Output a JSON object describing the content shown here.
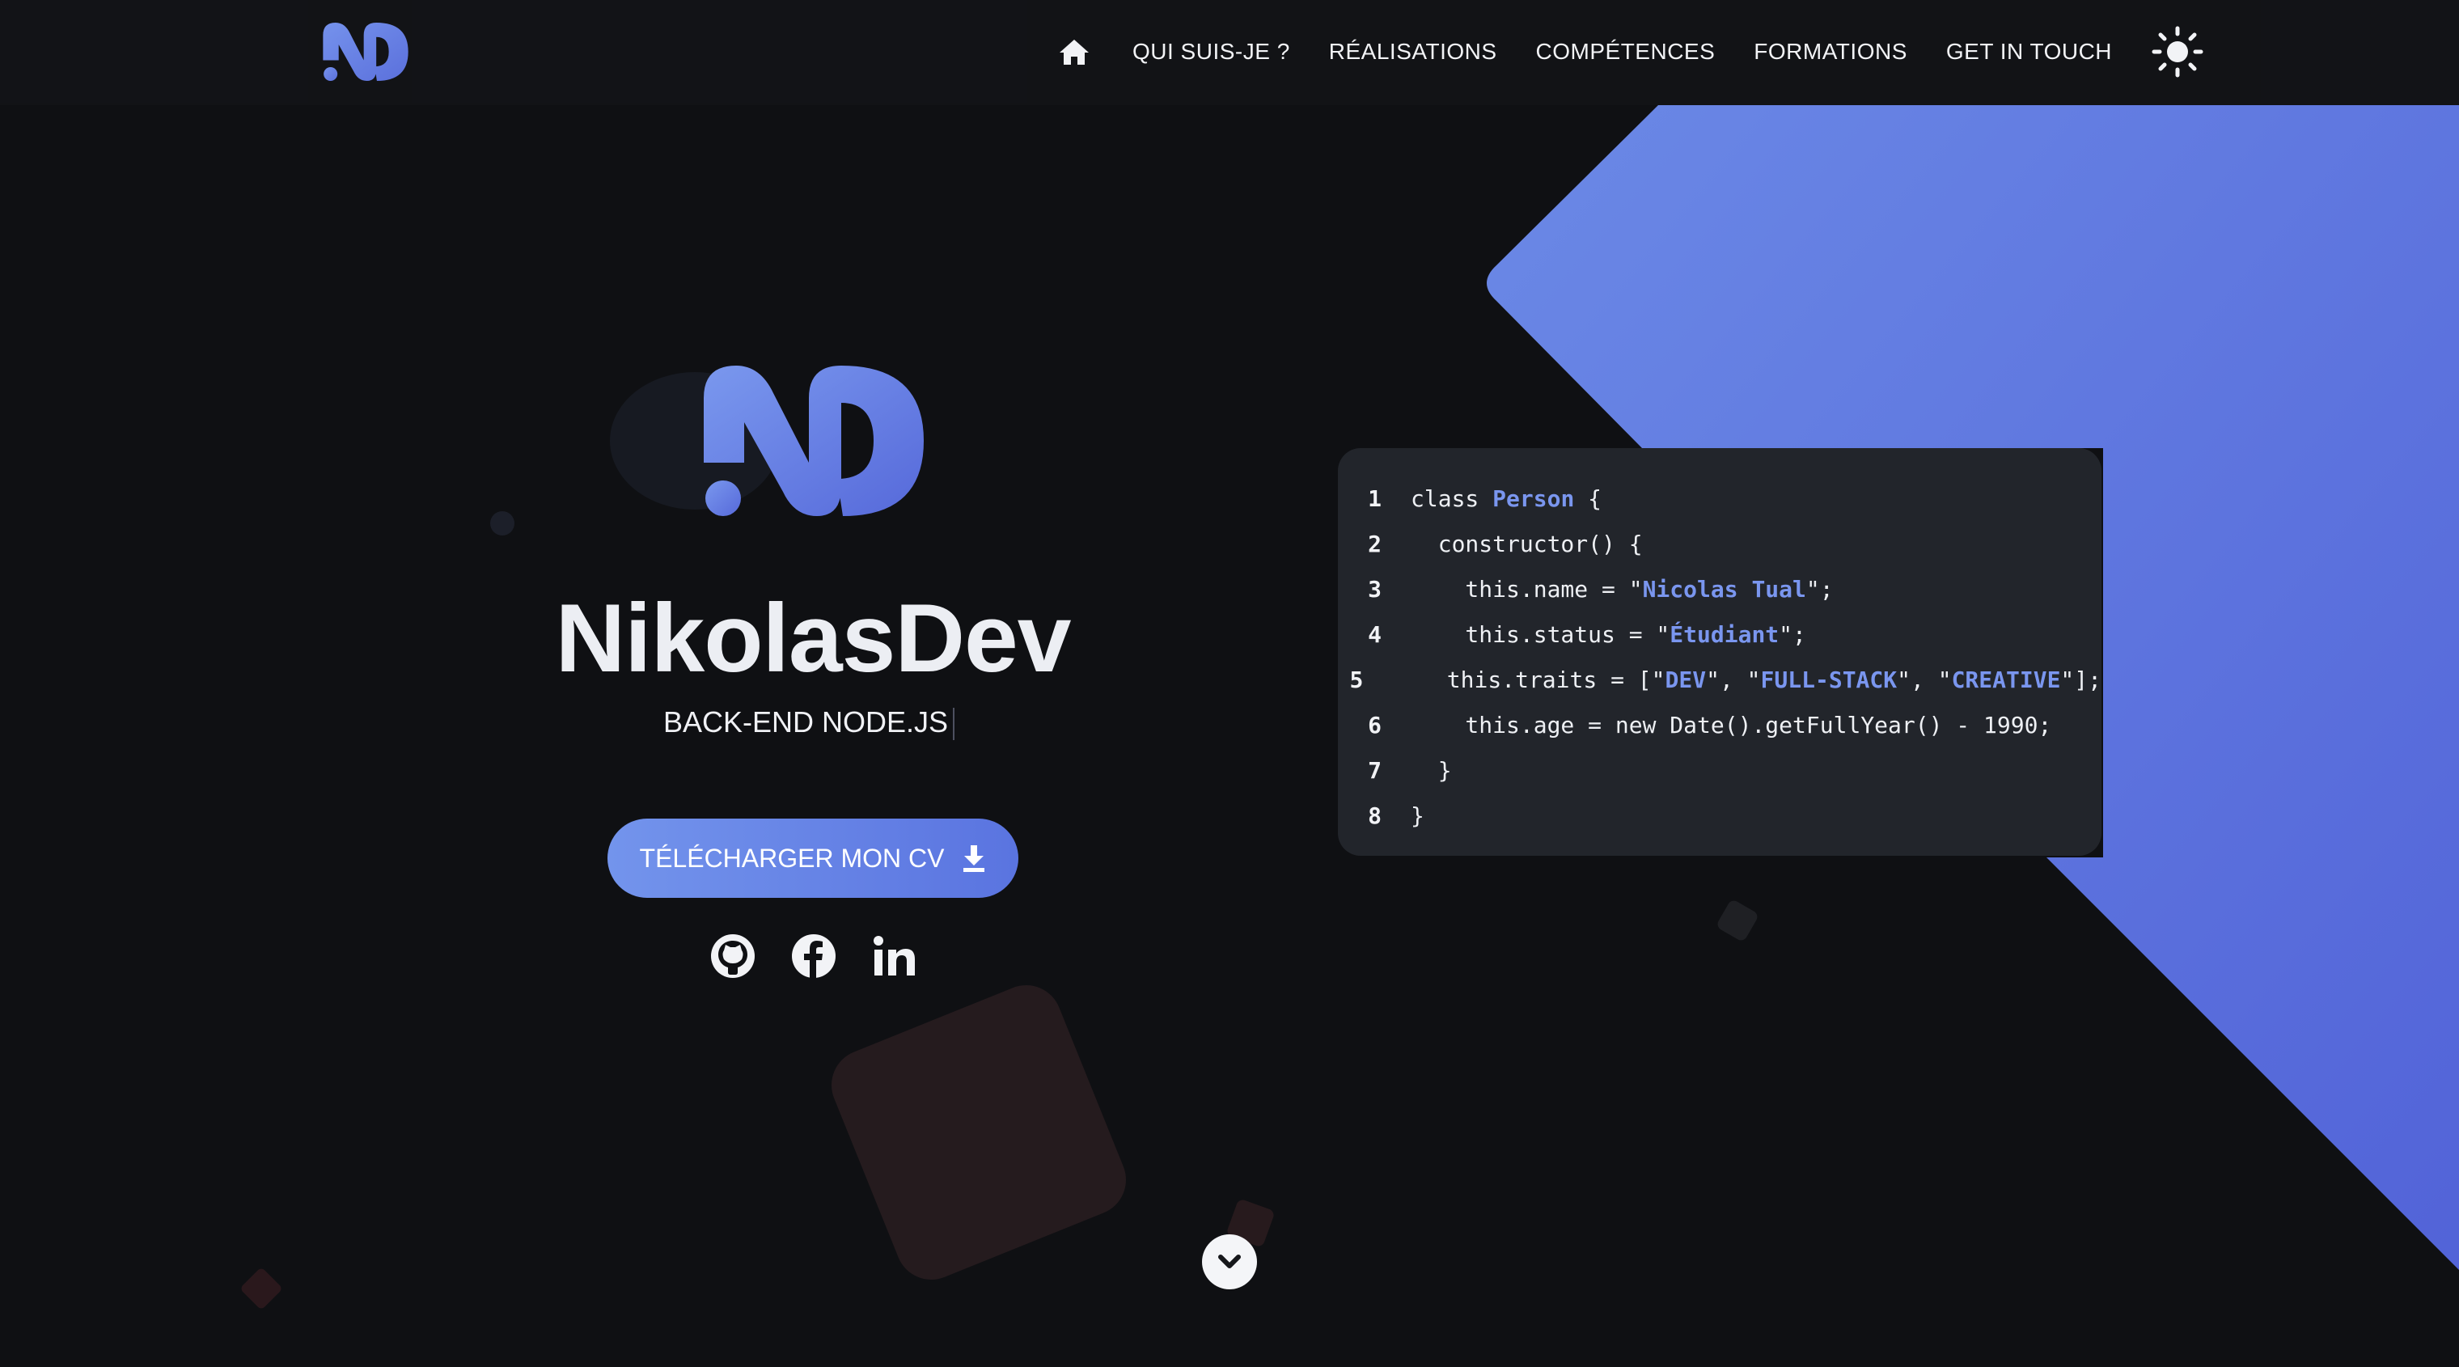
{
  "header": {
    "nav": [
      {
        "label": "QUI SUIS-JE ?"
      },
      {
        "label": "RÉALISATIONS"
      },
      {
        "label": "COMPÉTENCES"
      },
      {
        "label": "FORMATIONS"
      },
      {
        "label": "GET IN TOUCH"
      }
    ],
    "icons": {
      "home": "home-icon",
      "theme": "sun-icon"
    }
  },
  "hero": {
    "title": "NikolasDev",
    "subtitle": "BACK-END NODE.JS",
    "cv_button": "TÉLÉCHARGER MON CV",
    "socials": [
      "github-icon",
      "facebook-icon",
      "linkedin-icon"
    ]
  },
  "code": {
    "lines": [
      {
        "n": "1",
        "parts": [
          {
            "t": "class "
          },
          {
            "t": "Person",
            "hl": true
          },
          {
            "t": " {"
          }
        ]
      },
      {
        "n": "2",
        "parts": [
          {
            "t": "  constructor() {"
          }
        ]
      },
      {
        "n": "3",
        "parts": [
          {
            "t": "    this.name = \""
          },
          {
            "t": "Nicolas Tual",
            "hl": true
          },
          {
            "t": "\";"
          }
        ]
      },
      {
        "n": "4",
        "parts": [
          {
            "t": "    this.status = \""
          },
          {
            "t": "Étudiant",
            "hl": true
          },
          {
            "t": "\";"
          }
        ]
      },
      {
        "n": "5",
        "parts": [
          {
            "t": "    this.traits = [\""
          },
          {
            "t": "DEV",
            "hl": true
          },
          {
            "t": "\", \""
          },
          {
            "t": "FULL-STACK",
            "hl": true
          },
          {
            "t": "\", \""
          },
          {
            "t": "CREATIVE",
            "hl": true
          },
          {
            "t": "\"];"
          }
        ]
      },
      {
        "n": "6",
        "parts": [
          {
            "t": "    this.age = new Date().getFullYear() - 1990;"
          }
        ]
      },
      {
        "n": "7",
        "parts": [
          {
            "t": "  }"
          }
        ]
      },
      {
        "n": "8",
        "parts": [
          {
            "t": "}"
          }
        ]
      }
    ]
  },
  "colors": {
    "accent": "#6a86e6",
    "accent_dark": "#5a6fdc",
    "background": "#0f1013",
    "card": "#22252b",
    "highlight": "#7a96ef"
  }
}
